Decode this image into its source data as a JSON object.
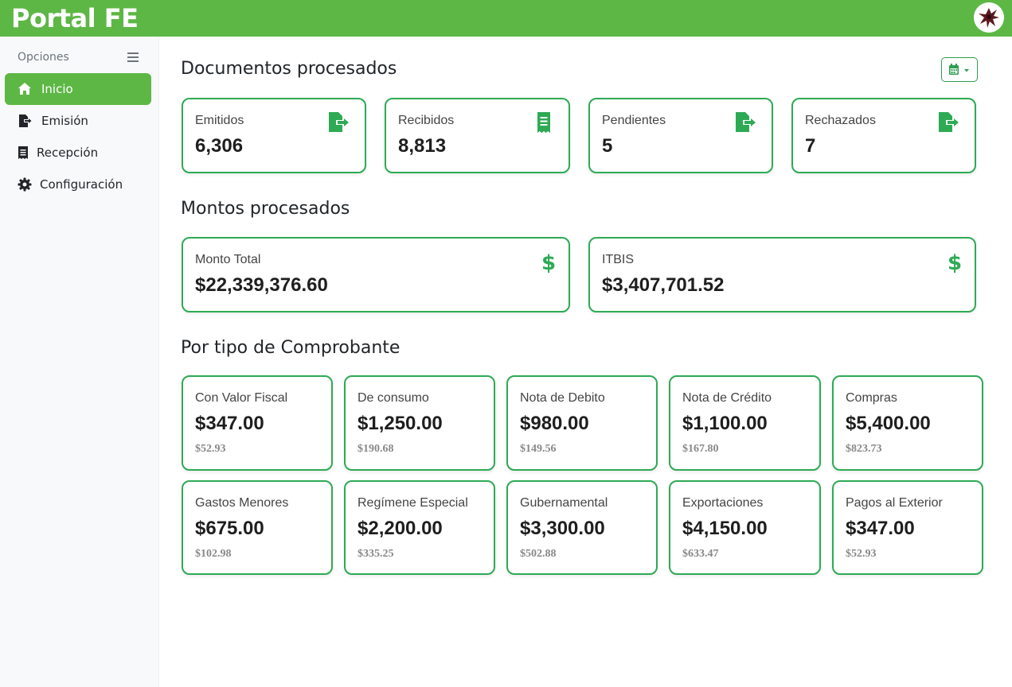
{
  "header": {
    "brand": "Portal FE"
  },
  "sidebar": {
    "heading": "Opciones",
    "items": [
      {
        "label": "Inicio",
        "icon": "home-icon",
        "active": true
      },
      {
        "label": "Emisión",
        "icon": "file-export-icon",
        "active": false
      },
      {
        "label": "Recepción",
        "icon": "receipt-icon",
        "active": false
      },
      {
        "label": "Configuración",
        "icon": "gear-icon",
        "active": false
      }
    ]
  },
  "documents": {
    "title": "Documentos procesados",
    "cards": [
      {
        "label": "Emitidos",
        "value": "6,306",
        "icon": "file-export-icon"
      },
      {
        "label": "Recibidos",
        "value": "8,813",
        "icon": "receipt-icon"
      },
      {
        "label": "Pendientes",
        "value": "5",
        "icon": "file-export-icon"
      },
      {
        "label": "Rechazados",
        "value": "7",
        "icon": "file-export-icon"
      }
    ]
  },
  "amounts": {
    "title": "Montos procesados",
    "cards": [
      {
        "label": "Monto Total",
        "value": "$22,339,376.60",
        "icon": "dollar-icon"
      },
      {
        "label": "ITBIS",
        "value": "$3,407,701.52",
        "icon": "dollar-icon"
      }
    ]
  },
  "by_type": {
    "title": "Por tipo de Comprobante",
    "cards": [
      {
        "label": "Con Valor Fiscal",
        "value": "$347.00",
        "sub": "$52.93"
      },
      {
        "label": "De consumo",
        "value": "$1,250.00",
        "sub": "$190.68"
      },
      {
        "label": "Nota de Debito",
        "value": "$980.00",
        "sub": "$149.56"
      },
      {
        "label": "Nota de Crédito",
        "value": "$1,100.00",
        "sub": "$167.80"
      },
      {
        "label": "Compras",
        "value": "$5,400.00",
        "sub": "$823.73"
      },
      {
        "label": "Gastos Menores",
        "value": "$675.00",
        "sub": "$102.98"
      },
      {
        "label": "Regímene Especial",
        "value": "$2,200.00",
        "sub": "$335.25"
      },
      {
        "label": "Gubernamental",
        "value": "$3,300.00",
        "sub": "$502.88"
      },
      {
        "label": "Exportaciones",
        "value": "$4,150.00",
        "sub": "$633.47"
      },
      {
        "label": "Pagos al Exterior",
        "value": "$347.00",
        "sub": "$52.93"
      }
    ]
  },
  "colors": {
    "brand_green": "#5db745",
    "card_border": "#2eaa55",
    "icon_green": "#2eaa55"
  }
}
